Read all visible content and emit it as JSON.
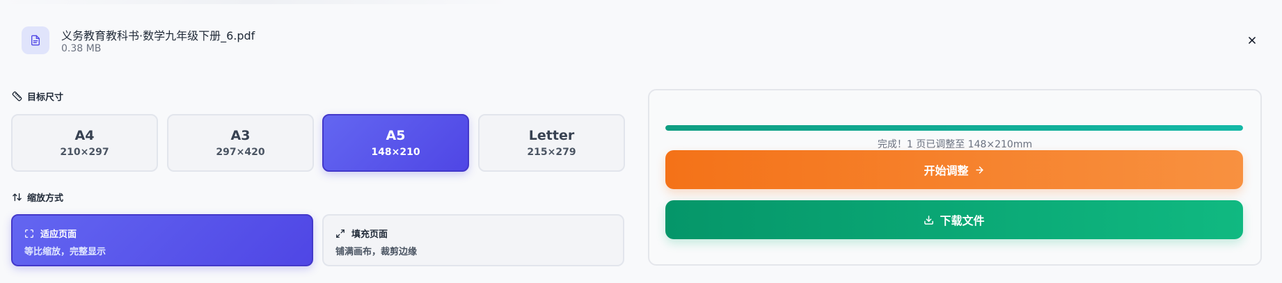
{
  "file": {
    "name": "义务教育教科书·数学九年级下册_6.pdf",
    "size": "0.38 MB",
    "icon": "document-icon"
  },
  "target_size": {
    "label": "目标尺寸",
    "icon": "ruler-icon",
    "options": [
      {
        "name": "A4",
        "dims": "210×297",
        "selected": false
      },
      {
        "name": "A3",
        "dims": "297×420",
        "selected": false
      },
      {
        "name": "A5",
        "dims": "148×210",
        "selected": true
      },
      {
        "name": "Letter",
        "dims": "215×279",
        "selected": false
      }
    ]
  },
  "scale_mode": {
    "label": "缩放方式",
    "icon": "swap-arrows-icon",
    "options": [
      {
        "title": "适应页面",
        "desc": "等比缩放，完整显示",
        "icon": "fit-frame-icon",
        "selected": true
      },
      {
        "title": "填充页面",
        "desc": "铺满画布，裁剪边缘",
        "icon": "expand-icon",
        "selected": false
      }
    ]
  },
  "result": {
    "progress_percent": 100,
    "status": "完成！1 页已调整至 148×210mm",
    "start_label": "开始调整",
    "download_label": "下载文件"
  },
  "colors": {
    "accent": "#4f46e5",
    "start_button": "#f47218",
    "download_button": "#059669",
    "progress": "#14b8a6"
  }
}
